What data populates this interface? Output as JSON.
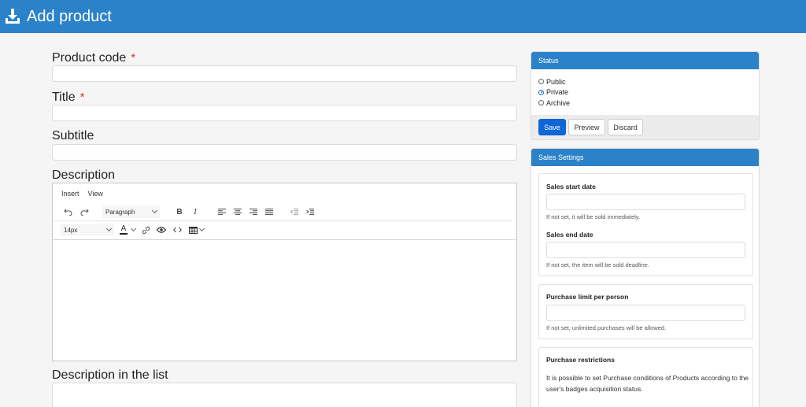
{
  "header": {
    "title": "Add product",
    "icon": "download-icon",
    "color": "#2b82c9"
  },
  "form": {
    "product_code_label": "Product code",
    "title_label": "Title",
    "subtitle_label": "Subtitle",
    "description_label": "Description",
    "description_list_label": "Description in the list",
    "required_mark": "*",
    "product_code_value": "",
    "title_value": "",
    "subtitle_value": "",
    "description_list_value": ""
  },
  "editor": {
    "menu": [
      "Insert",
      "View"
    ],
    "block_format": "Paragraph",
    "font_size": "14px",
    "bold": "B",
    "italic": "I",
    "font_color_letter": "A",
    "content": ""
  },
  "status_panel": {
    "title": "Status",
    "options": [
      "Public",
      "Private",
      "Archive"
    ],
    "selected": "Private",
    "save_label": "Save",
    "preview_label": "Preview",
    "discard_label": "Discard"
  },
  "sales_panel": {
    "title": "Sales Settings",
    "start_date_label": "Sales start date",
    "start_date_value": "",
    "start_date_hint": "If not set, it will be sold immediately.",
    "end_date_label": "Sales end date",
    "end_date_value": "",
    "end_date_hint": "If not set, the item will be sold deadline.",
    "limit_label": "Purchase limit per person",
    "limit_value": "",
    "limit_hint": "If not set, unlimited purchases will be allowed.",
    "restrictions_label": "Purchase restrictions",
    "restrictions_text": "It is possible to set Purchase conditions of Products according to the user's badges acquisition status."
  }
}
